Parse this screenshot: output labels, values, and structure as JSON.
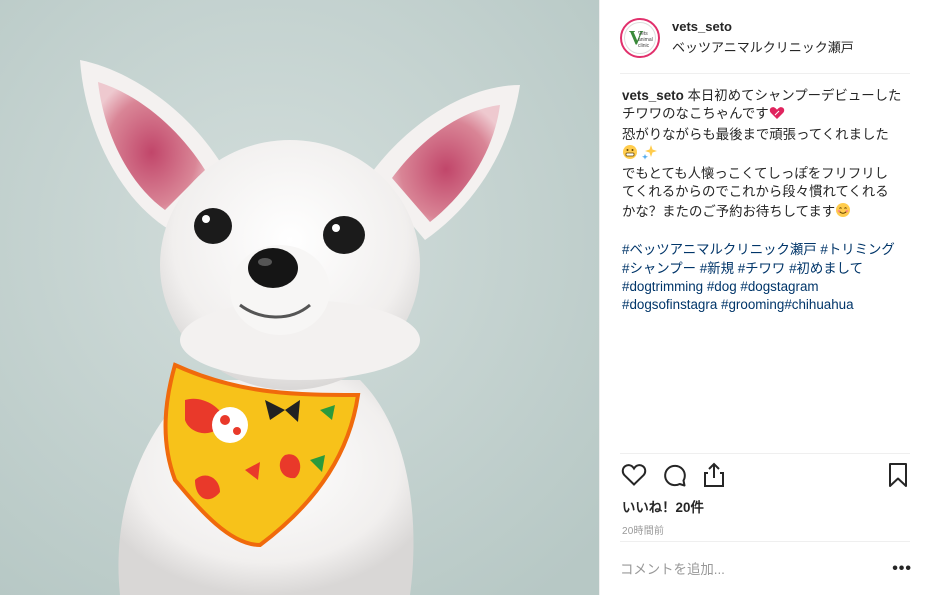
{
  "post": {
    "photo_icon": "chihuahua-photo",
    "header": {
      "username": "vets_seto",
      "location": "ベッツアニマルクリニック瀬戸",
      "avatar_icon": "clinic-logo",
      "avatar_text": "Vets animal clinic"
    },
    "caption": {
      "username": "vets_seto",
      "line1": "本日初めてシャンプーデビューした",
      "line2": "チワワのなこちゃんです",
      "line3": "恐がりながらも最後まで頑張ってくれました",
      "line4": "でもとても人懐っこくてしっぽをフリフリし",
      "line5": "てくれるからのでこれから段々慣れてくれる",
      "line6": "かな？またのご予約お待ちしてます",
      "hashtags_line1": [
        "#ベッツアニマルクリニック瀬戸",
        "#トリミング"
      ],
      "hashtags_line2": [
        "#シャンプー",
        "#新規",
        "#チワワ",
        "#初めまして"
      ],
      "hashtags_line3": [
        "#dogtrimming",
        "#dog",
        "#dogstagram"
      ],
      "hashtags_line4": [
        "#dogsofinstagra",
        "#grooming",
        "#chihuahua"
      ]
    },
    "actions": {
      "like_icon": "heart-icon",
      "comment_icon": "comment-icon",
      "share_icon": "share-icon",
      "save_icon": "bookmark-icon"
    },
    "likes_text": "いいね！20件",
    "time_text": "20時間前",
    "comment_placeholder": "コメントを追加...",
    "more_label": "•••"
  },
  "colors": {
    "hashtag": "#003569",
    "ring": "#e1306c",
    "background": "#c9d6d4",
    "bandana": "#f7c21a"
  }
}
